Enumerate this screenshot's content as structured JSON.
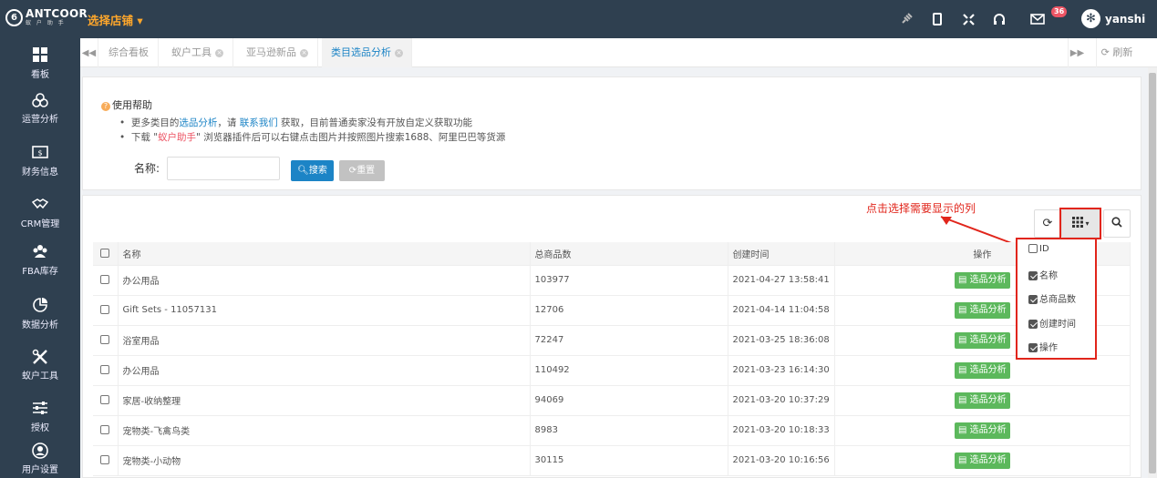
{
  "topbar": {
    "logo_text": "ANTCOOR",
    "logo_sub": "蚁 户 助 手",
    "store_label": "选择店铺 ▾",
    "mail_badge": "36",
    "username": "yanshi"
  },
  "sidebar": {
    "items": [
      {
        "label": "看板",
        "icon": "dashboard-icon"
      },
      {
        "label": "运营分析",
        "icon": "operations-icon"
      },
      {
        "label": "财务信息",
        "icon": "finance-icon"
      },
      {
        "label": "CRM管理",
        "icon": "crm-icon"
      },
      {
        "label": "FBA库存",
        "icon": "fba-icon"
      },
      {
        "label": "数据分析",
        "icon": "data-analysis-icon"
      },
      {
        "label": "蚁户工具",
        "icon": "tools-icon"
      },
      {
        "label": "授权",
        "icon": "auth-icon"
      },
      {
        "label": "用户设置",
        "icon": "user-settings-icon"
      }
    ]
  },
  "tabs": {
    "items": [
      {
        "label": "综合看板",
        "closable": false
      },
      {
        "label": "蚁户工具",
        "closable": true
      },
      {
        "label": "亚马逊新品",
        "closable": true
      },
      {
        "label": "类目选品分析",
        "closable": true
      }
    ],
    "refresh_label": "刷新"
  },
  "help": {
    "title": "使用帮助",
    "line1_a": "更多类目的",
    "line1_link1": "选品分析",
    "line1_b": "，请 ",
    "line1_link2": "联系我们",
    "line1_c": " 获取，目前普通卖家没有开放自定义获取功能",
    "line2_a": "下载 \"",
    "line2_link": "蚁户助手",
    "line2_b": "\" 浏览器插件后可以右键点击图片并按照图片搜索1688、阿里巴巴等货源"
  },
  "search": {
    "name_label": "名称:",
    "name_value": "",
    "search_button": "搜索",
    "reset_button": "重置"
  },
  "annotation": "点击选择需要显示的列",
  "table": {
    "headers": [
      "名称",
      "总商品数",
      "创建时间",
      "操作"
    ],
    "rows": [
      {
        "name": "办公用品",
        "count": "103977",
        "created": "2021-04-27 13:58:41"
      },
      {
        "name": "Gift Sets - 11057131",
        "count": "12706",
        "created": "2021-04-14 11:04:58"
      },
      {
        "name": "浴室用品",
        "count": "72247",
        "created": "2021-03-25 18:36:08"
      },
      {
        "name": "办公用品",
        "count": "110492",
        "created": "2021-03-23 16:14:30"
      },
      {
        "name": "家居-收纳整理",
        "count": "94069",
        "created": "2021-03-20 10:37:29"
      },
      {
        "name": "宠物类-飞禽鸟类",
        "count": "8983",
        "created": "2021-03-20 10:18:33"
      },
      {
        "name": "宠物类-小动物",
        "count": "30115",
        "created": "2021-03-20 10:16:56"
      }
    ],
    "action_label": "选品分析"
  },
  "columns_dropdown": {
    "items": [
      {
        "label": "ID",
        "checked": false
      },
      {
        "label": "名称",
        "checked": true
      },
      {
        "label": "总商品数",
        "checked": true
      },
      {
        "label": "创建时间",
        "checked": true
      },
      {
        "label": "操作",
        "checked": true
      }
    ]
  },
  "colors": {
    "sidebar_bg": "#2f4050",
    "primary": "#1c84c6",
    "success": "#5cb85c",
    "store_orange": "#ffa72b",
    "annotation_red": "#e1251b"
  }
}
